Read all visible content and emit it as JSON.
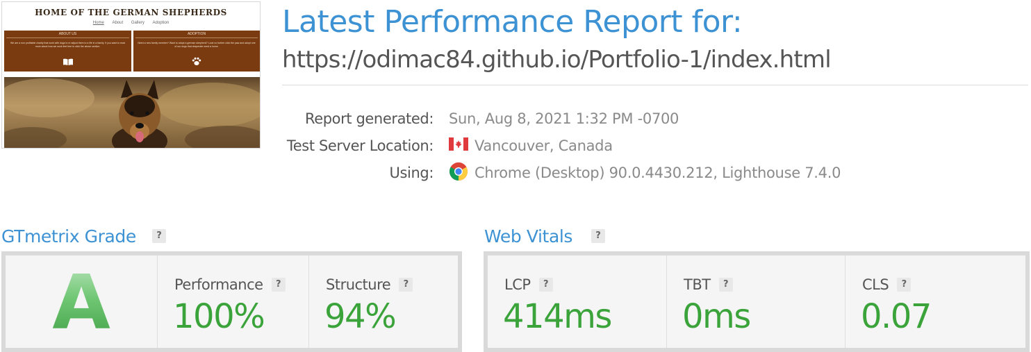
{
  "thumbnail": {
    "site_title": "HOME OF THE GERMAN SHEPHERDS",
    "nav": [
      "Home",
      "About",
      "Gallery",
      "Adoption"
    ],
    "panels": [
      {
        "heading": "ABOUT US",
        "text": "We are a non profitable charity that work with dogs to re adjust them to a life in a family. If you want to read more about how we work feel free to click the above section.",
        "icon": "book-icon"
      },
      {
        "heading": "ADOPTION",
        "text": "Need a new family member? Want to adopt a german shepherd? Look no further click the paw and adopt one of our dogs that desperate need a home.",
        "icon": "paw-icon"
      }
    ]
  },
  "header": {
    "title": "Latest Performance Report for:",
    "url": "https://odimac84.github.io/Portfolio-1/index.html"
  },
  "meta": {
    "generated_label": "Report generated:",
    "generated_value": "Sun, Aug 8, 2021 1:32 PM -0700",
    "location_label": "Test Server Location:",
    "location_value": "Vancouver, Canada",
    "location_icon": "canada-flag-icon",
    "using_label": "Using:",
    "using_value": "Chrome (Desktop) 90.0.4430.212, Lighthouse 7.4.0",
    "using_icon": "chrome-icon"
  },
  "grade_section": {
    "title": "GTmetrix Grade",
    "help": "?",
    "grade": "A",
    "performance_label": "Performance",
    "performance_value": "100%",
    "structure_label": "Structure",
    "structure_value": "94%"
  },
  "vitals_section": {
    "title": "Web Vitals",
    "help": "?",
    "lcp_label": "LCP",
    "lcp_value": "414ms",
    "tbt_label": "TBT",
    "tbt_value": "0ms",
    "cls_label": "CLS",
    "cls_value": "0.07"
  },
  "colors": {
    "accent_blue": "#3d92d4",
    "good_green": "#3aa33a",
    "panel_brown": "#7a3b10"
  }
}
